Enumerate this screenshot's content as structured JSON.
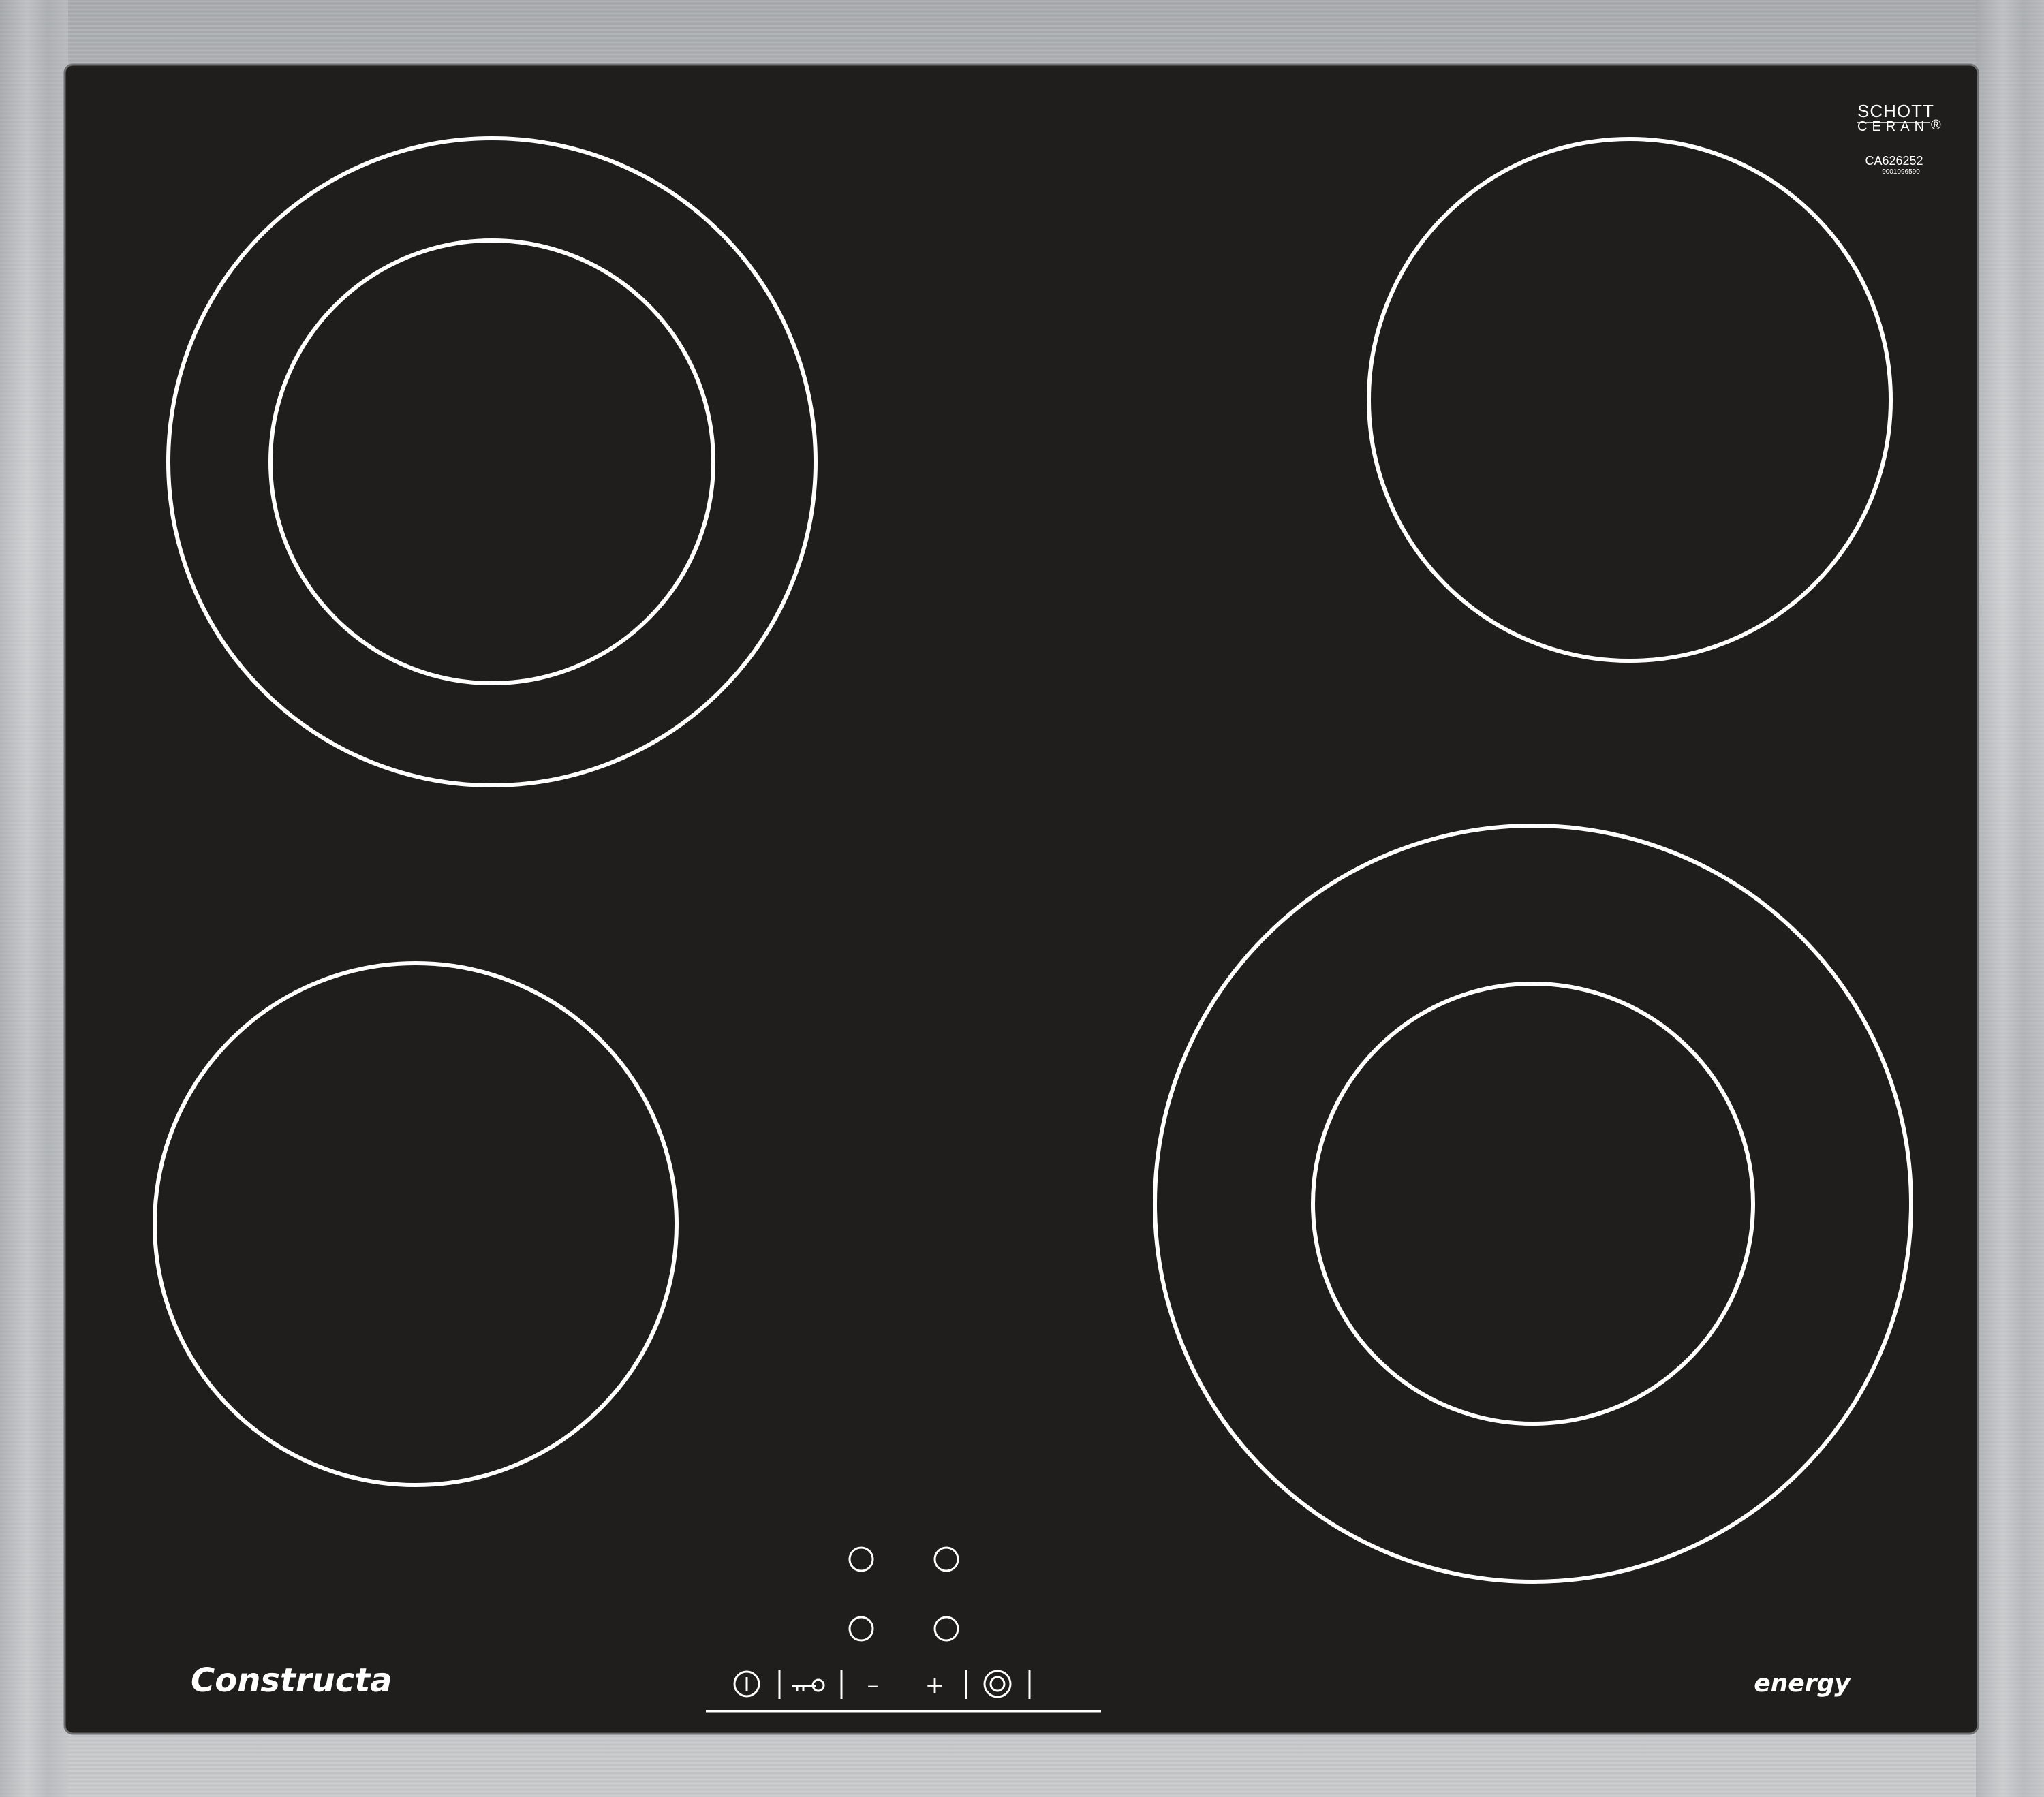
{
  "product": {
    "brand": "Constructa",
    "energy_label": "energy",
    "glass_maker_line1": "SCHOTT",
    "glass_maker_line2": "CERAN",
    "registered_mark": "®",
    "model_number": "CA626252",
    "serial_number": "9001096590"
  },
  "colors": {
    "frame": "#b9bcbe",
    "glass": "#1f1e1c",
    "markings": "#ffffff"
  },
  "cooking_zones": [
    {
      "name": "cooking-zone-front-left",
      "rings": 1
    },
    {
      "name": "cooking-zone-rear-left",
      "rings": 2
    },
    {
      "name": "cooking-zone-rear-right",
      "rings": 1
    },
    {
      "name": "cooking-zone-front-right",
      "rings": 2
    }
  ],
  "controls": {
    "power_icon": "power-icon",
    "lock_icon": "key-lock-icon",
    "minus_label": "–",
    "plus_label": "+",
    "zone_select_icon": "zone-select-icon",
    "indicator_count": 4
  }
}
